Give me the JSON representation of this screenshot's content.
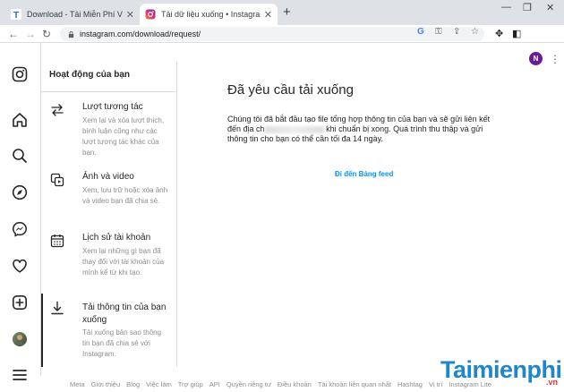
{
  "browser": {
    "tabs": [
      {
        "title": "Download - Tải Miễn Phí VN - Ph",
        "favicon": "taimienphi-t-icon"
      },
      {
        "title": "Tải dữ liệu xuống • Instagram",
        "favicon": "instagram-icon"
      }
    ],
    "new_tab": "+",
    "url": "instagram.com/download/request/",
    "profile_initial": "N",
    "window_controls": {
      "minimize": "—",
      "restore": "❐",
      "close": "✕"
    }
  },
  "menu": {
    "title": "Hoạt động của bạn",
    "items": [
      {
        "label": "Lượt tương tác",
        "desc": "Xem lại và xóa lượt thích, bình luận cũng như các lượt tương tác khác của bạn.",
        "icon": "interactions-icon"
      },
      {
        "label": "Ảnh và video",
        "desc": "Xem, lưu trữ hoặc xóa ảnh và video bạn đã chia sẻ.",
        "icon": "photos-videos-icon"
      },
      {
        "label": "Lịch sử tài khoản",
        "desc": "Xem lại những gì bạn đã thay đổi với tài khoản của mình kể từ khi tạo.",
        "icon": "calendar-icon"
      },
      {
        "label": "Tải thông tin của bạn xuống",
        "desc": "Tải xuống bản sao thông tin bạn đã chia sẻ với Instagram.",
        "icon": "download-icon"
      }
    ]
  },
  "content": {
    "heading": "Đã yêu cầu tải xuống",
    "para_before": "Chúng tôi đã bắt đầu tạo file tổng hợp thông tin của bạn và sẽ gửi liên kết đến địa ch",
    "para_after": "khi chuẩn bị xong. Quá trình thu thập và gửi thông tin cho bạn có thể cần tối đa 14 ngày.",
    "feed_link": "Đi đến Bảng feed"
  },
  "footer": [
    "Meta",
    "Giới thiệu",
    "Blog",
    "Việc làm",
    "Trợ giúp",
    "API",
    "Quyền riêng tư",
    "Điều khoản",
    "Tài khoản liên quan nhất",
    "Hashtag",
    "Vị trí",
    "Instagram Lite"
  ],
  "watermark": {
    "text": "Taimienphi",
    "suffix": ".vn"
  },
  "colors": {
    "link": "#0095f6",
    "tabbar": "#dee1e6",
    "border": "#dbdbdb"
  }
}
